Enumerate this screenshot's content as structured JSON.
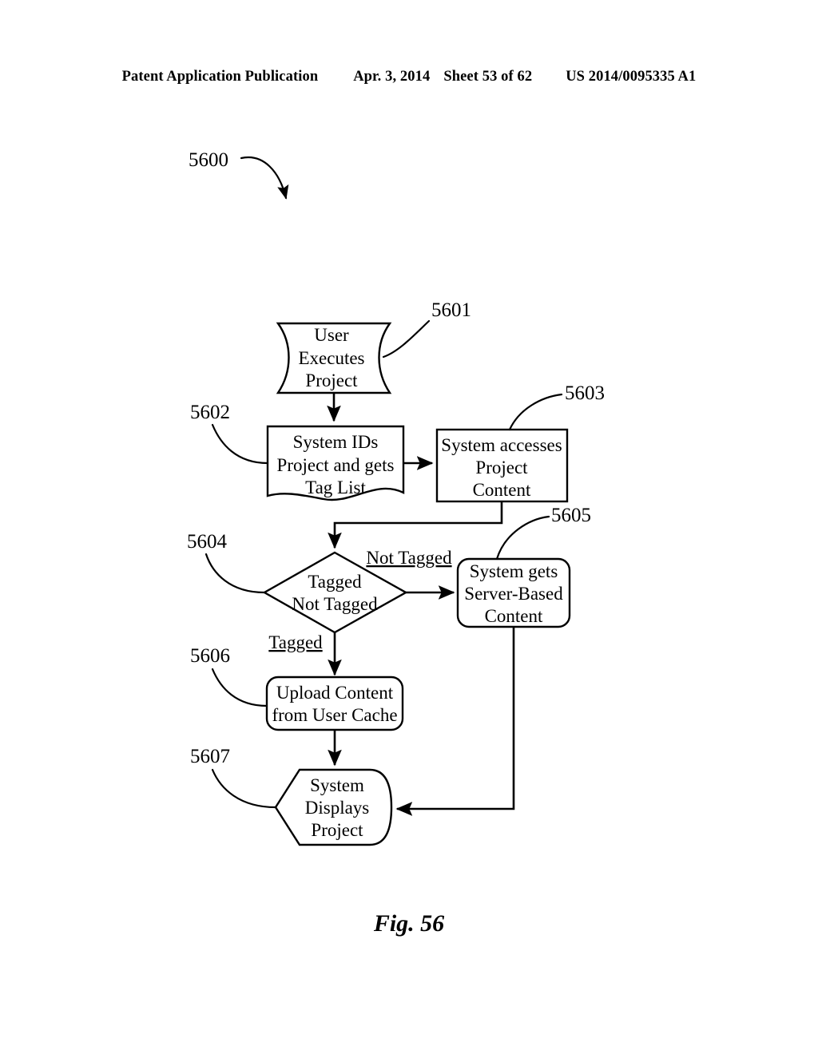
{
  "header": {
    "publication": "Patent Application Publication",
    "date": "Apr. 3, 2014",
    "sheet": "Sheet 53 of 62",
    "number": "US 2014/0095335 A1"
  },
  "figure": {
    "caption": "Fig. 56",
    "diagram_ref": "5600"
  },
  "chart_data": {
    "type": "diagram",
    "diagram_type": "flowchart",
    "title": "Fig. 56",
    "reference_numeral": "5600",
    "nodes": [
      {
        "id": "5601",
        "ref": "5601",
        "shape": "tape",
        "lines": [
          "User",
          "Executes",
          "Project"
        ],
        "text": "User Executes Project"
      },
      {
        "id": "5602",
        "ref": "5602",
        "shape": "document",
        "lines": [
          "System IDs",
          "Project and gets",
          "Tag List"
        ],
        "text": "System IDs Project and gets Tag List"
      },
      {
        "id": "5603",
        "ref": "5603",
        "shape": "rectangle",
        "lines": [
          "System accesses",
          "Project",
          "Content"
        ],
        "text": "System accesses Project Content"
      },
      {
        "id": "5604",
        "ref": "5604",
        "shape": "diamond",
        "lines": [
          "Tagged",
          "Not Tagged"
        ],
        "text": "Tagged Not Tagged"
      },
      {
        "id": "5605",
        "ref": "5605",
        "shape": "rounded-rectangle",
        "lines": [
          "System gets",
          "Server-Based",
          "Content"
        ],
        "text": "System gets Server-Based Content"
      },
      {
        "id": "5606",
        "ref": "5606",
        "shape": "rounded-rectangle",
        "lines": [
          "Upload Content",
          "from User Cache"
        ],
        "text": "Upload Content from User Cache"
      },
      {
        "id": "5607",
        "ref": "5607",
        "shape": "hexagon-rounded",
        "lines": [
          "System",
          "Displays",
          "Project"
        ],
        "text": "System Displays Project"
      }
    ],
    "edges": [
      {
        "from": "5601",
        "to": "5602",
        "label": ""
      },
      {
        "from": "5602",
        "to": "5603",
        "label": ""
      },
      {
        "from": "5603",
        "to": "5604",
        "label": ""
      },
      {
        "from": "5604",
        "to": "5605",
        "label": "Not Tagged"
      },
      {
        "from": "5604",
        "to": "5606",
        "label": "Tagged"
      },
      {
        "from": "5606",
        "to": "5607",
        "label": ""
      },
      {
        "from": "5605",
        "to": "5607",
        "label": ""
      }
    ],
    "edge_labels": {
      "not_tagged": "Not Tagged",
      "tagged": "Tagged"
    }
  }
}
